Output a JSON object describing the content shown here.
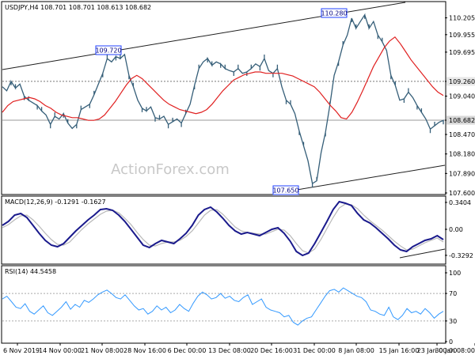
{
  "chart_data": [
    {
      "type": "line",
      "panel": "price",
      "title": "USDJPY,H4  108.701 108.701 108.613 108.682",
      "watermark": "ActionForex.com",
      "ylim": [
        107.6,
        110.4
      ],
      "y_ticks": [
        "110.205",
        "109.955",
        "109.695",
        "109.260",
        "109.040",
        "108.682",
        "108.470",
        "108.180",
        "107.890",
        "107.600"
      ],
      "y_tick_values": [
        110.205,
        109.955,
        109.695,
        109.26,
        109.04,
        108.682,
        108.47,
        108.18,
        107.89,
        107.6
      ],
      "x_ticks": [
        "6 Nov 2019",
        "14 Nov 00:00",
        "21 Nov 08:00",
        "28 Nov 16:00",
        "6 Dec 00:00",
        "13 Dec 08:00",
        "20 Dec 16:00",
        "31 Dec 00:00",
        "8 Jan 08:00",
        "15 Jan 16:00",
        "23 Jan 00:00",
        "30 Jan 08:00"
      ],
      "price_close": [
        109.18,
        109.12,
        109.26,
        109.16,
        109.22,
        109.04,
        108.98,
        108.94,
        108.9,
        108.82,
        108.76,
        108.62,
        108.74,
        108.7,
        108.78,
        108.64,
        108.56,
        108.62,
        108.84,
        108.88,
        108.92,
        109.06,
        109.22,
        109.38,
        109.6,
        109.55,
        109.63,
        109.6,
        109.66,
        109.35,
        109.18,
        108.98,
        108.86,
        108.82,
        108.88,
        108.72,
        108.7,
        108.74,
        108.62,
        108.66,
        108.7,
        108.64,
        108.78,
        108.92,
        109.2,
        109.45,
        109.55,
        109.6,
        109.5,
        109.55,
        109.52,
        109.45,
        109.42,
        109.4,
        109.45,
        109.38,
        109.4,
        109.45,
        109.52,
        109.48,
        109.6,
        109.42,
        109.38,
        109.45,
        109.18,
        108.98,
        108.92,
        108.78,
        108.52,
        108.3,
        108.08,
        107.74,
        107.78,
        108.2,
        108.5,
        108.9,
        109.35,
        109.55,
        109.8,
        109.95,
        110.2,
        110.05,
        110.15,
        110.25,
        110.05,
        110.15,
        109.95,
        109.85,
        109.72,
        109.35,
        109.2,
        108.98,
        109.0,
        109.1,
        109.02,
        108.9,
        108.8,
        108.7,
        108.55,
        108.6,
        108.65,
        108.68
      ],
      "ma_values": [
        108.8,
        108.9,
        108.96,
        108.98,
        109.0,
        109.02,
        109.0,
        108.96,
        108.9,
        108.86,
        108.8,
        108.76,
        108.74,
        108.72,
        108.72,
        108.7,
        108.68,
        108.68,
        108.7,
        108.76,
        108.86,
        108.96,
        109.08,
        109.2,
        109.3,
        109.35,
        109.3,
        109.22,
        109.14,
        109.06,
        108.98,
        108.92,
        108.88,
        108.84,
        108.82,
        108.8,
        108.78,
        108.8,
        108.84,
        108.92,
        109.02,
        109.12,
        109.2,
        109.28,
        109.32,
        109.36,
        109.38,
        109.4,
        109.4,
        109.38,
        109.38,
        109.38,
        109.38,
        109.36,
        109.34,
        109.3,
        109.26,
        109.22,
        109.18,
        109.1,
        109.0,
        108.9,
        108.82,
        108.72,
        108.7,
        108.8,
        108.95,
        109.12,
        109.3,
        109.48,
        109.62,
        109.76,
        109.86,
        109.92,
        109.82,
        109.7,
        109.58,
        109.48,
        109.38,
        109.28,
        109.18,
        109.1,
        109.05
      ],
      "trendline_labels": {
        "upper": "109.720",
        "top": "110.280",
        "low": "107.650"
      },
      "horizontal_lines": [
        109.26,
        108.682
      ],
      "current_value_label": "108.682",
      "highlight_value_label": "109.260"
    },
    {
      "type": "line",
      "panel": "macd",
      "title": "MACD(12,26,9) -0.1291 -0.1627",
      "ylim": [
        -0.42,
        0.38
      ],
      "y_ticks": [
        "0.3404",
        "0.00",
        "-0.3292"
      ],
      "y_tick_values": [
        0.3404,
        0.0,
        -0.3292
      ],
      "macd_main": [
        0.05,
        0.1,
        0.18,
        0.2,
        0.15,
        0.05,
        -0.05,
        -0.14,
        -0.2,
        -0.22,
        -0.18,
        -0.1,
        -0.02,
        0.05,
        0.12,
        0.18,
        0.25,
        0.26,
        0.24,
        0.18,
        0.1,
        0.0,
        -0.1,
        -0.2,
        -0.23,
        -0.18,
        -0.14,
        -0.16,
        -0.18,
        -0.12,
        -0.05,
        0.05,
        0.18,
        0.25,
        0.28,
        0.22,
        0.14,
        0.05,
        -0.02,
        -0.06,
        -0.04,
        -0.06,
        -0.08,
        -0.04,
        0.0,
        0.02,
        -0.05,
        -0.15,
        -0.28,
        -0.33,
        -0.3,
        -0.18,
        -0.04,
        0.1,
        0.25,
        0.35,
        0.33,
        0.3,
        0.2,
        0.12,
        0.08,
        0.02,
        -0.05,
        -0.12,
        -0.2,
        -0.26,
        -0.28,
        -0.22,
        -0.18,
        -0.14,
        -0.12,
        -0.08,
        -0.13
      ],
      "macd_signal": [
        0.02,
        0.06,
        0.12,
        0.17,
        0.18,
        0.12,
        0.04,
        -0.05,
        -0.13,
        -0.19,
        -0.2,
        -0.16,
        -0.08,
        0.0,
        0.07,
        0.13,
        0.19,
        0.23,
        0.24,
        0.21,
        0.14,
        0.06,
        -0.04,
        -0.13,
        -0.2,
        -0.21,
        -0.18,
        -0.16,
        -0.16,
        -0.14,
        -0.09,
        -0.02,
        0.08,
        0.18,
        0.24,
        0.25,
        0.19,
        0.11,
        0.03,
        -0.02,
        -0.04,
        -0.05,
        -0.06,
        -0.06,
        -0.03,
        0.0,
        -0.01,
        -0.08,
        -0.18,
        -0.27,
        -0.3,
        -0.25,
        -0.13,
        0.01,
        0.15,
        0.27,
        0.32,
        0.31,
        0.26,
        0.18,
        0.11,
        0.05,
        -0.01,
        -0.08,
        -0.15,
        -0.21,
        -0.26,
        -0.25,
        -0.21,
        -0.17,
        -0.14,
        -0.11,
        -0.16
      ]
    },
    {
      "type": "line",
      "panel": "rsi",
      "title": "RSI(14) 44.5458",
      "ylim": [
        0,
        100
      ],
      "y_ticks": [
        "100",
        "70",
        "30",
        "0"
      ],
      "y_tick_values": [
        100,
        70,
        30,
        0
      ],
      "values": [
        62,
        66,
        58,
        50,
        48,
        55,
        44,
        40,
        46,
        52,
        42,
        38,
        44,
        50,
        58,
        47,
        54,
        50,
        60,
        57,
        62,
        68,
        72,
        75,
        70,
        64,
        62,
        68,
        60,
        52,
        46,
        48,
        40,
        44,
        52,
        46,
        50,
        42,
        46,
        54,
        48,
        44,
        56,
        66,
        72,
        68,
        62,
        64,
        70,
        63,
        66,
        60,
        58,
        64,
        68,
        54,
        58,
        62,
        50,
        46,
        44,
        42,
        36,
        38,
        28,
        24,
        30,
        34,
        36,
        46,
        56,
        66,
        74,
        76,
        72,
        78,
        74,
        70,
        66,
        64,
        58,
        46,
        44,
        40,
        38,
        50,
        36,
        32,
        38,
        48,
        42,
        44,
        40,
        48,
        42,
        34,
        40,
        44
      ]
    }
  ]
}
